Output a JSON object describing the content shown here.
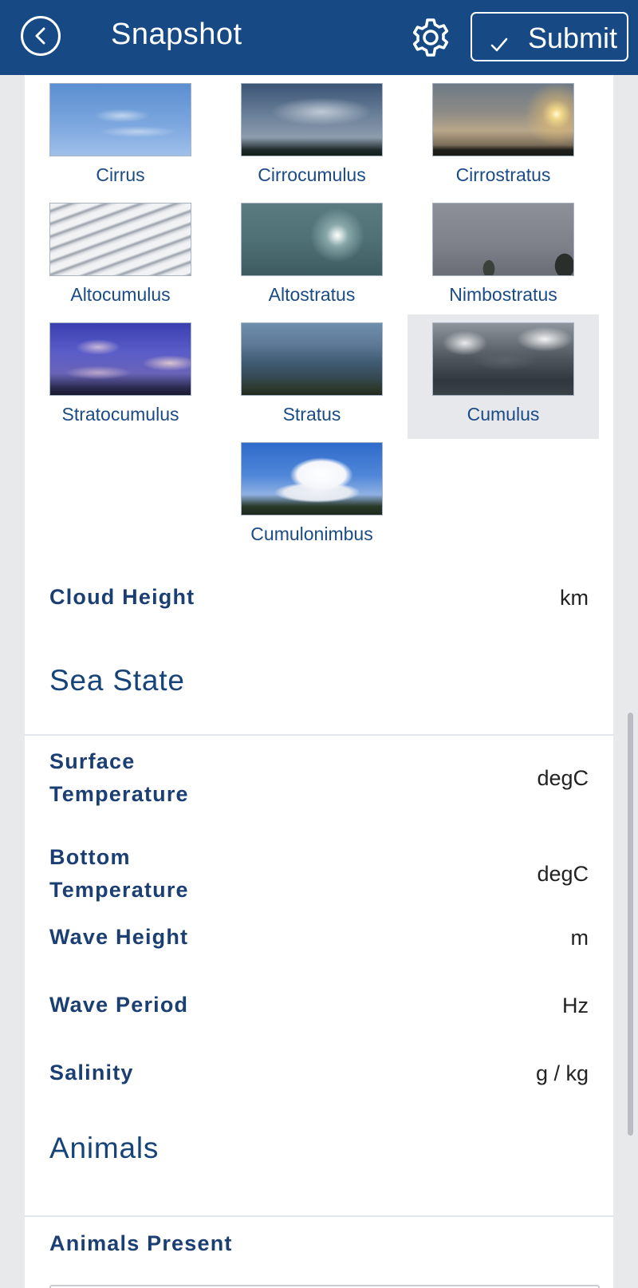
{
  "header": {
    "title": "Snapshot",
    "submit_label": "Submit",
    "back_icon": "back-circle-icon",
    "settings_icon": "gear-icon",
    "submit_icon": "checkmark-icon"
  },
  "clouds": {
    "selected": "Cumulus",
    "items": [
      {
        "label": "Cirrus"
      },
      {
        "label": "Cirrocumulus"
      },
      {
        "label": "Cirrostratus"
      },
      {
        "label": "Altocumulus"
      },
      {
        "label": "Altostratus"
      },
      {
        "label": "Nimbostratus"
      },
      {
        "label": "Stratocumulus"
      },
      {
        "label": "Stratus"
      },
      {
        "label": "Cumulus"
      },
      {
        "label": "Cumulonimbus"
      }
    ]
  },
  "cloud_height": {
    "label": "Cloud Height",
    "unit": "km"
  },
  "sea_state": {
    "title": "Sea State",
    "rows": [
      {
        "label": "Surface Temperature",
        "unit": "degC"
      },
      {
        "label": "Bottom Temperature",
        "unit": "degC"
      },
      {
        "label": "Wave Height",
        "unit": "m"
      },
      {
        "label": "Wave Period",
        "unit": "Hz"
      },
      {
        "label": "Salinity",
        "unit": "g / kg"
      }
    ]
  },
  "animals": {
    "title": "Animals",
    "present_label": "Animals Present"
  }
}
